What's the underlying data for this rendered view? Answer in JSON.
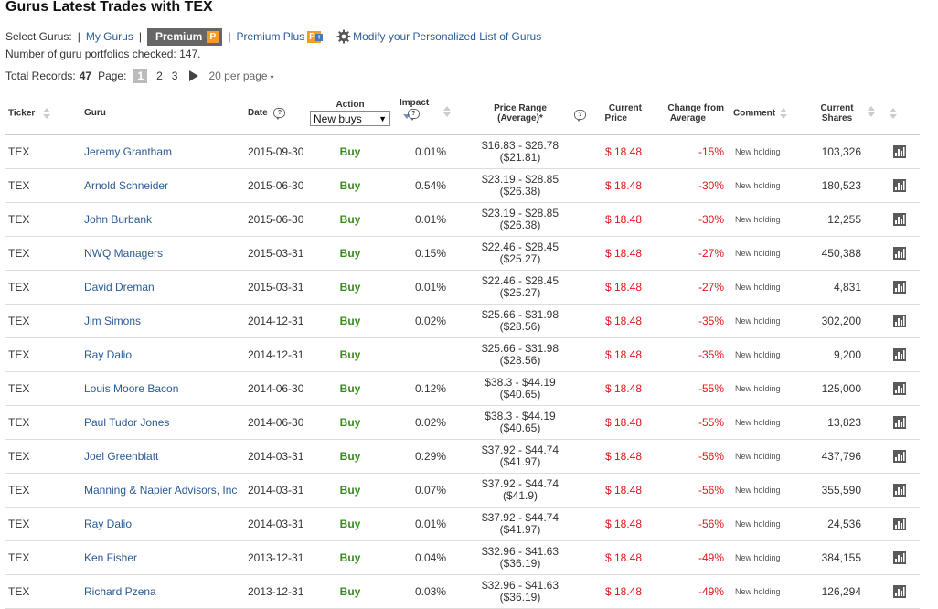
{
  "title": "Gurus Latest Trades with TEX",
  "guru_selector": {
    "label": "Select Gurus:",
    "separator": "|",
    "my_gurus": "My Gurus",
    "premium": "Premium",
    "premium_badge": "P",
    "premium_plus": "Premium Plus",
    "premium_plus_badge": "P",
    "premium_plus_badge_plus": "+",
    "modify": "Modify your Personalized List of Gurus"
  },
  "portfolios_checked": "Number of guru portfolios checked: 147.",
  "pager": {
    "total_label": "Total Records:",
    "total": "47",
    "page_label": "Page:",
    "pages": [
      "1",
      "2",
      "3"
    ],
    "current_page": "1",
    "per_page": "20 per page",
    "per_page_caret": "▾"
  },
  "columns": {
    "ticker": "Ticker",
    "guru": "Guru",
    "date": "Date",
    "action": "Action",
    "action_filter": "New buys",
    "action_caret": "▼",
    "impact": "Impact",
    "price_range_line1": "Price Range",
    "price_range_line2": "(Average)*",
    "current_price_line1": "Current",
    "current_price_line2": "Price",
    "change_line1": "Change from",
    "change_line2": "Average",
    "comment": "Comment",
    "shares_line1": "Current",
    "shares_line2": "Shares",
    "help_glyph": "?"
  },
  "rows": [
    {
      "ticker": "TEX",
      "guru": "Jeremy Grantham",
      "date": "2015-09-30",
      "action": "Buy",
      "impact": "0.01%",
      "range": "$16.83 - $26.78",
      "avg": "($21.81)",
      "price": "$ 18.48",
      "change": "-15%",
      "comment": "New holding",
      "shares": "103,326"
    },
    {
      "ticker": "TEX",
      "guru": "Arnold Schneider",
      "date": "2015-06-30",
      "action": "Buy",
      "impact": "0.54%",
      "range": "$23.19 - $28.85",
      "avg": "($26.38)",
      "price": "$ 18.48",
      "change": "-30%",
      "comment": "New holding",
      "shares": "180,523"
    },
    {
      "ticker": "TEX",
      "guru": "John Burbank",
      "date": "2015-06-30",
      "action": "Buy",
      "impact": "0.01%",
      "range": "$23.19 - $28.85",
      "avg": "($26.38)",
      "price": "$ 18.48",
      "change": "-30%",
      "comment": "New holding",
      "shares": "12,255"
    },
    {
      "ticker": "TEX",
      "guru": "NWQ Managers",
      "date": "2015-03-31",
      "action": "Buy",
      "impact": "0.15%",
      "range": "$22.46 - $28.45",
      "avg": "($25.27)",
      "price": "$ 18.48",
      "change": "-27%",
      "comment": "New holding",
      "shares": "450,388"
    },
    {
      "ticker": "TEX",
      "guru": "David Dreman",
      "date": "2015-03-31",
      "action": "Buy",
      "impact": "0.01%",
      "range": "$22.46 - $28.45",
      "avg": "($25.27)",
      "price": "$ 18.48",
      "change": "-27%",
      "comment": "New holding",
      "shares": "4,831"
    },
    {
      "ticker": "TEX",
      "guru": "Jim Simons",
      "date": "2014-12-31",
      "action": "Buy",
      "impact": "0.02%",
      "range": "$25.66 - $31.98",
      "avg": "($28.56)",
      "price": "$ 18.48",
      "change": "-35%",
      "comment": "New holding",
      "shares": "302,200"
    },
    {
      "ticker": "TEX",
      "guru": "Ray Dalio",
      "date": "2014-12-31",
      "action": "Buy",
      "impact": "",
      "range": "$25.66 - $31.98",
      "avg": "($28.56)",
      "price": "$ 18.48",
      "change": "-35%",
      "comment": "New holding",
      "shares": "9,200"
    },
    {
      "ticker": "TEX",
      "guru": "Louis Moore Bacon",
      "date": "2014-06-30",
      "action": "Buy",
      "impact": "0.12%",
      "range": "$38.3 - $44.19",
      "avg": "($40.65)",
      "price": "$ 18.48",
      "change": "-55%",
      "comment": "New holding",
      "shares": "125,000"
    },
    {
      "ticker": "TEX",
      "guru": "Paul Tudor Jones",
      "date": "2014-06-30",
      "action": "Buy",
      "impact": "0.02%",
      "range": "$38.3 - $44.19",
      "avg": "($40.65)",
      "price": "$ 18.48",
      "change": "-55%",
      "comment": "New holding",
      "shares": "13,823"
    },
    {
      "ticker": "TEX",
      "guru": "Joel Greenblatt",
      "date": "2014-03-31",
      "action": "Buy",
      "impact": "0.29%",
      "range": "$37.92 - $44.74",
      "avg": "($41.97)",
      "price": "$ 18.48",
      "change": "-56%",
      "comment": "New holding",
      "shares": "437,796"
    },
    {
      "ticker": "TEX",
      "guru": "Manning & Napier Advisors, Inc",
      "date": "2014-03-31",
      "action": "Buy",
      "impact": "0.07%",
      "range": "$37.92 - $44.74",
      "avg": "($41.9)",
      "price": "$ 18.48",
      "change": "-56%",
      "comment": "New holding",
      "shares": "355,590"
    },
    {
      "ticker": "TEX",
      "guru": "Ray Dalio",
      "date": "2014-03-31",
      "action": "Buy",
      "impact": "0.01%",
      "range": "$37.92 - $44.74",
      "avg": "($41.97)",
      "price": "$ 18.48",
      "change": "-56%",
      "comment": "New holding",
      "shares": "24,536"
    },
    {
      "ticker": "TEX",
      "guru": "Ken Fisher",
      "date": "2013-12-31",
      "action": "Buy",
      "impact": "0.04%",
      "range": "$32.96 - $41.63",
      "avg": "($36.19)",
      "price": "$ 18.48",
      "change": "-49%",
      "comment": "New holding",
      "shares": "384,155"
    },
    {
      "ticker": "TEX",
      "guru": "Richard Pzena",
      "date": "2013-12-31",
      "action": "Buy",
      "impact": "0.03%",
      "range": "$32.96 - $41.63",
      "avg": "($36.19)",
      "price": "$ 18.48",
      "change": "-49%",
      "comment": "New holding",
      "shares": "126,294"
    }
  ],
  "icons": {
    "gear": "gear-icon",
    "chart": "bar-chart-icon",
    "next": "next-page-icon",
    "help": "help-bubble-icon"
  },
  "colors": {
    "link": "#2a5b94",
    "buy": "#3a8a1f",
    "negative": "#e0161b",
    "premium_bg": "#666666",
    "badge": "#f39c29"
  }
}
